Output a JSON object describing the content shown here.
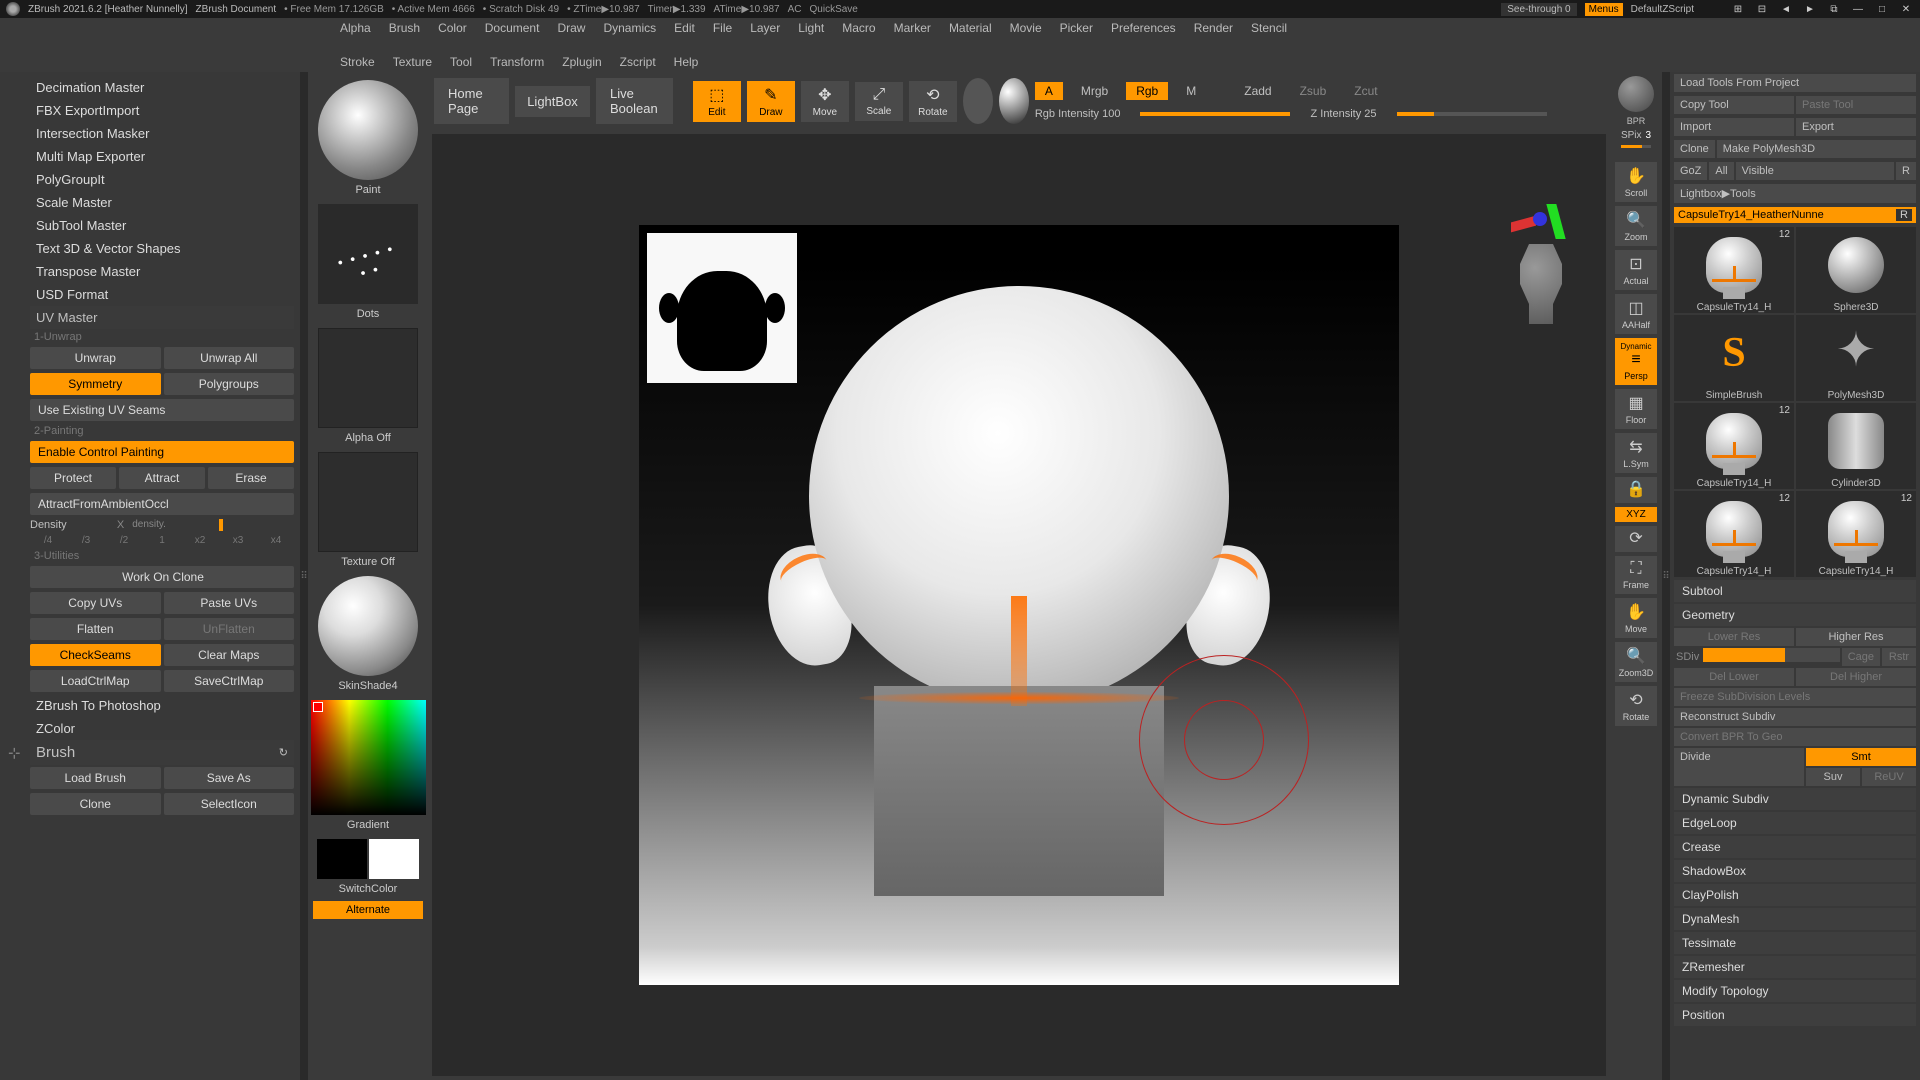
{
  "title": {
    "app": "ZBrush 2021.6.2 [Heather Nunnelly]",
    "doc": "ZBrush Document",
    "freemem": "Free Mem 17.126GB",
    "activemem": "Active Mem 4666",
    "scratch": "Scratch Disk 49",
    "ztime": "ZTime▶10.987",
    "timer": "Timer▶1.339",
    "atime": "ATime▶10.987",
    "ac": "AC",
    "quicksave": "QuickSave",
    "seethrough": "See-through  0",
    "menus": "Menus",
    "zscript": "DefaultZScript"
  },
  "menu": {
    "row1": [
      "Alpha",
      "Brush",
      "Color",
      "Document",
      "Draw",
      "Dynamics",
      "Edit",
      "File",
      "Layer",
      "Light",
      "Macro",
      "Marker",
      "Material",
      "Movie",
      "Picker",
      "Preferences",
      "Render",
      "Stencil"
    ],
    "row2": [
      "Stroke",
      "Texture",
      "Tool",
      "Transform",
      "Zplugin",
      "Zscript",
      "Help"
    ]
  },
  "left": {
    "plugins": [
      "Decimation Master",
      "FBX ExportImport",
      "Intersection Masker",
      "Multi Map Exporter",
      "PolyGroupIt",
      "Scale Master",
      "SubTool Master",
      "Text 3D & Vector Shapes",
      "Transpose Master",
      "USD Format"
    ],
    "uvmaster": "UV Master",
    "unwrap_sec": "1-Unwrap",
    "unwrap": "Unwrap",
    "unwrap_all": "Unwrap All",
    "symmetry": "Symmetry",
    "polygroups": "Polygroups",
    "use_existing": "Use Existing UV Seams",
    "painting_sec": "2-Painting",
    "enable_cp": "Enable Control Painting",
    "protect": "Protect",
    "attract": "Attract",
    "erase": "Erase",
    "attract_ao": "AttractFromAmbientOccl",
    "density": "Density",
    "density_x": "X",
    "density_val": "density.",
    "d4": "/4",
    "d3": "/3",
    "d2": "/2",
    "d1": "1",
    "x2": "x2",
    "x3": "x3",
    "x4": "x4",
    "util_sec": "3-Utilities",
    "work_clone": "Work On Clone",
    "copy_uv": "Copy UVs",
    "paste_uv": "Paste UVs",
    "flatten": "Flatten",
    "unflatten": "UnFlatten",
    "checkseams": "CheckSeams",
    "clearmaps": "Clear Maps",
    "loadctrl": "LoadCtrlMap",
    "savectrl": "SaveCtrlMap",
    "zb2ps": "ZBrush To Photoshop",
    "zcolor": "ZColor",
    "brush_header": "Brush",
    "load_brush": "Load Brush",
    "save_as": "Save As",
    "clone": "Clone",
    "select_icon": "SelectIcon"
  },
  "brushpanel": {
    "paint": "Paint",
    "dots": "Dots",
    "alpha_off": "Alpha Off",
    "texture_off": "Texture Off",
    "mat": "SkinShade4",
    "gradient": "Gradient",
    "switchcolor": "SwitchColor",
    "alternate": "Alternate"
  },
  "toolbar": {
    "home": "Home Page",
    "lightbox": "LightBox",
    "livebool": "Live Boolean",
    "edit": "Edit",
    "draw": "Draw",
    "move": "Move",
    "scale": "Scale",
    "rotate": "Rotate",
    "a": "A",
    "mrgb": "Mrgb",
    "rgb": "Rgb",
    "m": "M",
    "zadd": "Zadd",
    "zsub": "Zsub",
    "zcut": "Zcut",
    "rgb_int": "Rgb Intensity 100",
    "z_int": "Z Intensity 25"
  },
  "rightstrip": {
    "bpr": "BPR",
    "spix": "SPix",
    "spix_val": "3",
    "scroll": "Scroll",
    "zoom": "Zoom",
    "actual": "Actual",
    "aahalf": "AAHalf",
    "dynamic": "Dynamic",
    "persp": "Persp",
    "floor": "Floor",
    "lsym": "L.Sym",
    "xyz": "XYZ",
    "frame": "Frame",
    "move": "Move",
    "zoom3d": "Zoom3D",
    "rotate": "Rotate"
  },
  "right": {
    "load_tools": "Load Tools From Project",
    "copy_tool": "Copy Tool",
    "paste_tool": "Paste Tool",
    "import": "Import",
    "export": "Export",
    "clone": "Clone",
    "make_pm3d": "Make PolyMesh3D",
    "goz": "GoZ",
    "all": "All",
    "visible": "Visible",
    "r": "R",
    "lightbox_tools": "Lightbox▶Tools",
    "current_tool": "CapsuleTry14_HeatherNunne",
    "tools": [
      {
        "label": "CapsuleTry14_H",
        "shape": "head",
        "num": "12"
      },
      {
        "label": "Sphere3D",
        "shape": "sphere",
        "num": ""
      },
      {
        "label": "SimpleBrush",
        "shape": "sbrush",
        "num": ""
      },
      {
        "label": "PolyMesh3D",
        "shape": "star",
        "num": ""
      },
      {
        "label": "CapsuleTry14_H",
        "shape": "head",
        "num": "12"
      },
      {
        "label": "Cylinder3D",
        "shape": "cyl",
        "num": ""
      },
      {
        "label": "CapsuleTry14_H",
        "shape": "head",
        "num": "12"
      }
    ],
    "subtool": "Subtool",
    "geometry": "Geometry",
    "lower_res": "Lower Res",
    "higher_res": "Higher Res",
    "sdiv": "SDiv",
    "cage": "Cage",
    "rstr": "Rstr",
    "del_lower": "Del Lower",
    "del_higher": "Del Higher",
    "freeze": "Freeze SubDivision Levels",
    "reconstruct": "Reconstruct Subdiv",
    "convert_bpr": "Convert BPR To Geo",
    "divide": "Divide",
    "smt": "Smt",
    "suv": "Suv",
    "reuv": "ReUV",
    "sections": [
      "Dynamic Subdiv",
      "EdgeLoop",
      "Crease",
      "ShadowBox",
      "ClayPolish",
      "DynaMesh",
      "Tessimate",
      "ZRemesher",
      "Modify Topology",
      "Position"
    ]
  }
}
